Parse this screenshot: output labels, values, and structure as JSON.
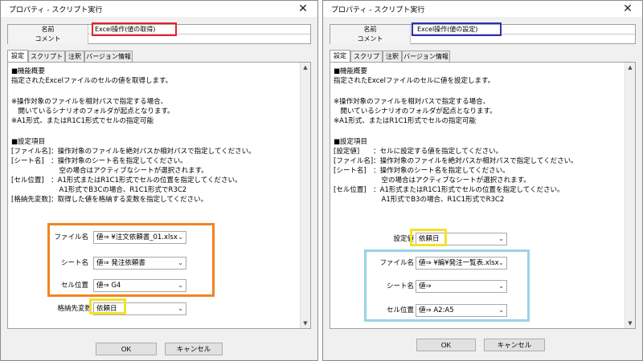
{
  "left_dialog": {
    "title": "プロパティ - スクリプト実行",
    "name_label": "名前",
    "name_value": "Excel操作(値の取得)",
    "comment_label": "コメント",
    "comment_value": "",
    "tabs": [
      "設定",
      "スクリプト",
      "注釈",
      "バージョン情報"
    ],
    "lines": [
      "■機能概要",
      "指定されたExcelファイルのセルの値を取得します。",
      "※操作対象のファイルを相対パスで指定する場合、",
      "　開いているシナリオのフォルダが起点となります。",
      "※A1形式、またはR1C1形式でセルの指定可能",
      "■設定項目",
      "[ファイル名]：操作対象のファイルを絶対パスか相対パスで指定してください。",
      "[シート名]　：操作対象のシート名を指定してください。",
      "　　　　　　　空の場合はアクティブなシートが選択されます。",
      "[セル位置]　：A1形式またはR1C1形式でセルの位置を指定してください。",
      "　　　　　　　A1形式でB3Cの場合、R1C1形式でR3C2",
      "[格納先変数]：取得した値を格納する変数を指定してください。"
    ],
    "fields": [
      {
        "label": "ファイル名",
        "value": "値⇒ ¥注文依頼書_01.xlsx"
      },
      {
        "label": "シート名",
        "value": "値⇒ 発注依頼書"
      },
      {
        "label": "セル位置",
        "value": "値⇒ G4"
      },
      {
        "label": "格納先変数",
        "value": "依頼日"
      }
    ],
    "ok_label": "OK",
    "cancel_label": "キャンセル"
  },
  "right_dialog": {
    "title": "プロパティ - スクリプト実行",
    "name_label": "名前",
    "name_value": "Excel操作(値の設定)",
    "comment_label": "コメント",
    "comment_value": "",
    "tabs": [
      "設定",
      "スクリプト",
      "注釈",
      "バージョン情報"
    ],
    "lines": [
      "■機能概要",
      "指定されたExcelファイルのセルに値を設定します。",
      "※操作対象のファイルを相対パスで指定する場合、",
      "　開いているシナリオのフォルダが起点となります。",
      "※A1形式、またはR1C1形式でセルの指定可能",
      "■設定項目",
      "[設定値]　　：セルに設定する値を指定してください。",
      "[ファイル名]：操作対象のファイルを絶対パスか相対パスで指定してください。",
      "[シート名]　：操作対象のシート名を指定してください。",
      "　　　　　　　空の場合はアクティブなシートが選択されます。",
      "[セル位置]　：A1形式またはR1C1形式でセルの位置を指定してください。",
      "　　　　　　　A1形式でB3の場合、R1C1形式でR3C2"
    ],
    "fields": [
      {
        "label": "設定値",
        "value": "依頼日"
      },
      {
        "label": "ファイル名",
        "value": "値⇒ ¥編¥発注一覧表.xlsx"
      },
      {
        "label": "シート名",
        "value": "値⇒"
      },
      {
        "label": "セル位置",
        "value": "値⇒ A2:A5"
      }
    ],
    "ok_label": "OK",
    "cancel_label": "キャンセル"
  },
  "icons": {
    "close": "close-icon",
    "dropdown": "chevron-down-icon",
    "scroll_up": "scroll-up-icon",
    "scroll_down": "scroll-down-icon"
  },
  "highlight_colors": {
    "red": "#e8202a",
    "blue": "#2d2fb6",
    "orange": "#f28423",
    "yellow": "#f4e12a",
    "light_blue": "#9ad3e6"
  }
}
